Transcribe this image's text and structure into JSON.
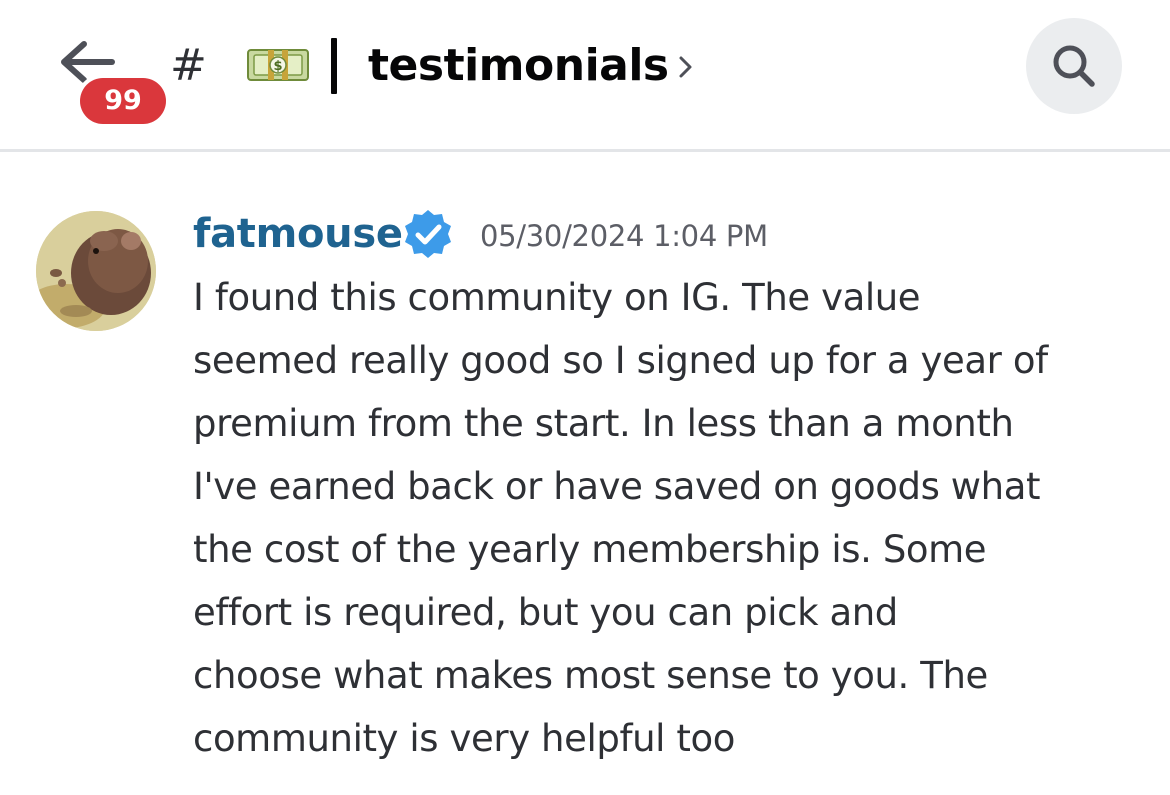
{
  "header": {
    "back_badge_count": "99",
    "channel_hash": "#",
    "channel_emoji_icon": "money-with-wings-banknote-icon",
    "channel_separator": "|",
    "channel_name": "testimonials",
    "chevron_icon": "chevron-right-icon",
    "search_icon": "search-icon",
    "badge_color": "#da373c"
  },
  "message": {
    "author": "fatmouse",
    "author_color": "#1f6390",
    "verified_icon": "verified-badge-icon",
    "timestamp": "05/30/2024 1:04 PM",
    "lines": [
      "I found this community on IG. The value",
      "seemed really good so I signed up for a year of",
      "premium from the start. In less than a month",
      "I've earned back or have saved on goods what",
      "the cost of the yearly membership is. Some",
      "effort is required, but you can pick and",
      "choose what makes most sense to you. The",
      "community is very helpful too"
    ]
  }
}
